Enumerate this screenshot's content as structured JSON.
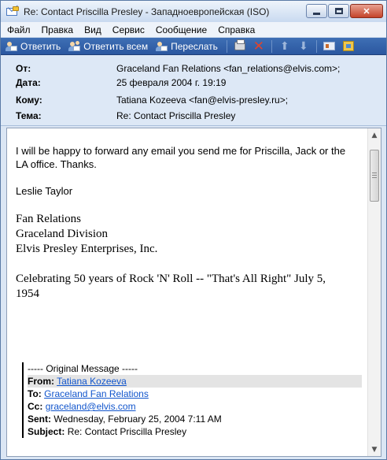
{
  "window": {
    "title": "Re: Contact Priscilla Presley - Западноевропейская (ISO)",
    "close_label": "✕"
  },
  "menu": [
    "Файл",
    "Правка",
    "Вид",
    "Сервис",
    "Сообщение",
    "Справка"
  ],
  "toolbar": {
    "reply_label": "Ответить",
    "reply_all_label": "Ответить всем",
    "forward_label": "Переслать",
    "icons": [
      "reply-icon",
      "reply-all-icon",
      "forward-icon",
      "print-icon",
      "delete-icon",
      "previous-icon",
      "next-icon",
      "addresses-icon",
      "grid-icon"
    ]
  },
  "header": {
    "from_label": "От:",
    "from_value": "Graceland Fan Relations <fan_relations@elvis.com>;",
    "date_label": "Дата:",
    "date_value": "25 февраля 2004 г. 19:19",
    "to_label": "Кому:",
    "to_value": "Tatiana Kozeeva <fan@elvis-presley.ru>;",
    "subject_label": "Тема:",
    "subject_value": "Re: Contact Priscilla Presley"
  },
  "body": {
    "para1_line1": "I will be happy to forward any email you send me for Priscilla, Jack or the",
    "para1_line2": "LA office.  Thanks.",
    "signature_name": "Leslie Taylor",
    "sig_line1": "Fan Relations",
    "sig_line2": "Graceland Division",
    "sig_line3": "Elvis Presley Enterprises, Inc.",
    "celebrating_line1": "Celebrating 50 years of Rock 'N' Roll  -- \"That's All Right\"  July 5,",
    "celebrating_line2": "1954"
  },
  "quote": {
    "original_header": "----- Original Message -----",
    "from_label": "From:",
    "from_value": "Tatiana Kozeeva",
    "to_label": "To:",
    "to_value": "Graceland Fan Relations",
    "cc_label": "Cc:",
    "cc_value": "graceland@elvis.com",
    "sent_label": "Sent:",
    "sent_value": "Wednesday, February 25, 2004 7:11 AM",
    "subject_label": "Subject:",
    "subject_value": "Re: Contact Priscilla Presley"
  },
  "colors": {
    "toolbar": "#2b57a0",
    "header_bg": "#dde8f6",
    "link": "#1155cc",
    "quoted_from_highlight": "#e4e4e4"
  }
}
